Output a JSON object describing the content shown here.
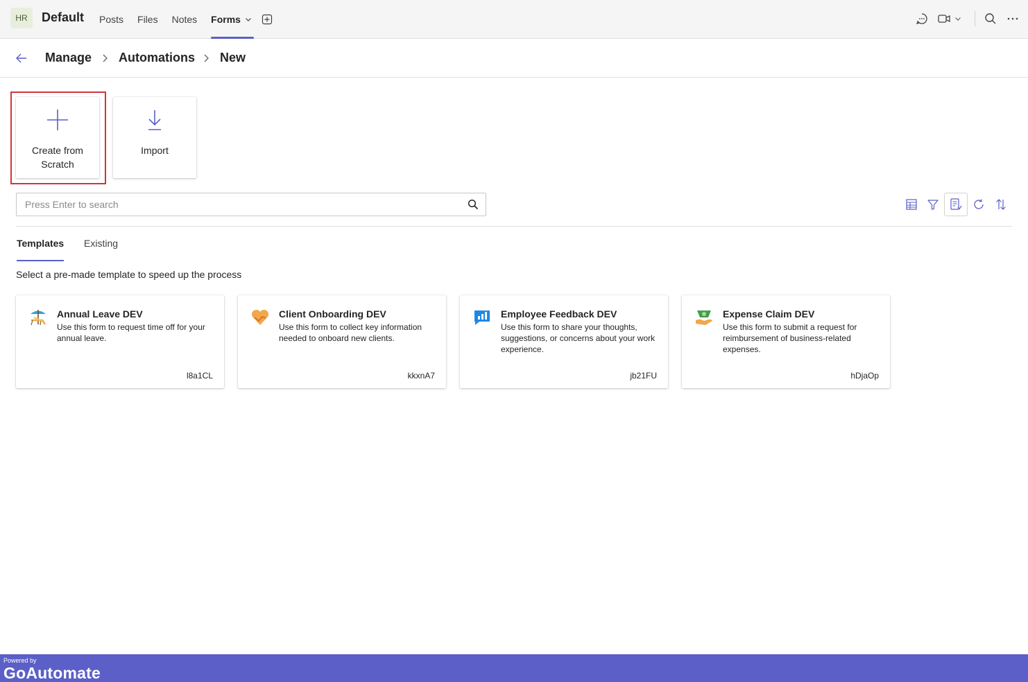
{
  "header": {
    "avatar_initials": "HR",
    "team_name": "Default",
    "tabs": [
      {
        "label": "Posts"
      },
      {
        "label": "Files"
      },
      {
        "label": "Notes"
      },
      {
        "label": "Forms"
      }
    ],
    "active_tab": "Forms",
    "icons": [
      "chat-icon",
      "video-icon",
      "chevron-down-icon",
      "search-icon",
      "more-icon"
    ]
  },
  "breadcrumb": {
    "items": [
      "Manage",
      "Automations",
      "New"
    ]
  },
  "actions": {
    "create_label": "Create from Scratch",
    "import_label": "Import"
  },
  "search": {
    "placeholder": "Press Enter to search",
    "value": ""
  },
  "subtabs": {
    "items": [
      "Templates",
      "Existing"
    ],
    "active": "Templates"
  },
  "hint": "Select a pre-made template to speed up the process",
  "templates": [
    {
      "title": "Annual Leave DEV",
      "description": "Use this form to request time off for your annual leave.",
      "code": "l8a1CL",
      "icon": "beach-chair-icon"
    },
    {
      "title": "Client Onboarding DEV",
      "description": "Use this form to collect key information needed to onboard new clients.",
      "code": "kkxnA7",
      "icon": "handshake-heart-icon"
    },
    {
      "title": "Employee Feedback DEV",
      "description": "Use this form to share your thoughts, suggestions, or concerns about your work experience.",
      "code": "jb21FU",
      "icon": "feedback-chart-icon"
    },
    {
      "title": "Expense Claim DEV",
      "description": "Use this form to submit a request for reimbursement of business-related expenses.",
      "code": "hDjaOp",
      "icon": "money-hand-icon"
    }
  ],
  "footer": {
    "powered_by": "Powered by",
    "brand": "GoAutomate"
  },
  "colors": {
    "accent": "#5b5fc7",
    "highlight": "#d13438"
  }
}
